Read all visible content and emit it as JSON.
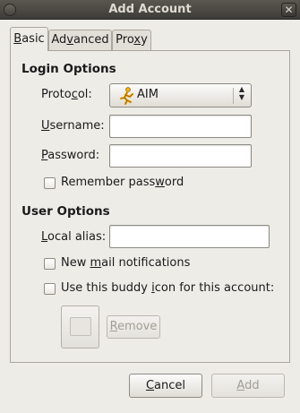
{
  "window": {
    "title": "Add Account",
    "close_glyph": "✕"
  },
  "tabs": [
    {
      "label": "Basic",
      "mnemonic": "B",
      "rest": "asic"
    },
    {
      "label": "Advanced",
      "pre": "Ad",
      "mnemonic": "v",
      "rest": "anced"
    },
    {
      "label": "Proxy",
      "pre": "Pro",
      "mnemonic": "x",
      "rest": "y"
    }
  ],
  "login_options": {
    "heading": "Login Options",
    "protocol": {
      "pre": "Proto",
      "mnemonic": "c",
      "rest": "ol:",
      "value": "AIM",
      "icon": "aim-running-man-icon"
    },
    "username": {
      "mnemonic": "U",
      "rest": "sername:",
      "value": ""
    },
    "password": {
      "mnemonic": "P",
      "rest": "assword:",
      "value": ""
    },
    "remember": {
      "pre": "Remember pass",
      "mnemonic": "w",
      "rest": "ord",
      "checked": false
    }
  },
  "user_options": {
    "heading": "User Options",
    "alias": {
      "mnemonic": "L",
      "rest": "ocal alias:",
      "value": ""
    },
    "new_mail": {
      "pre": "New ",
      "mnemonic": "m",
      "rest": "ail notifications",
      "checked": false
    },
    "buddy_icon": {
      "pre": "Use this buddy ",
      "mnemonic": "i",
      "rest": "con for this account:",
      "checked": false
    },
    "remove": {
      "mnemonic": "R",
      "rest": "emove"
    }
  },
  "buttons": {
    "cancel": {
      "mnemonic": "C",
      "rest": "ancel"
    },
    "add": {
      "mnemonic": "A",
      "rest": "dd"
    }
  },
  "colors": {
    "titlebar": "#4a4843",
    "window_bg": "#eeece7",
    "aim_orange": "#e9a311"
  }
}
